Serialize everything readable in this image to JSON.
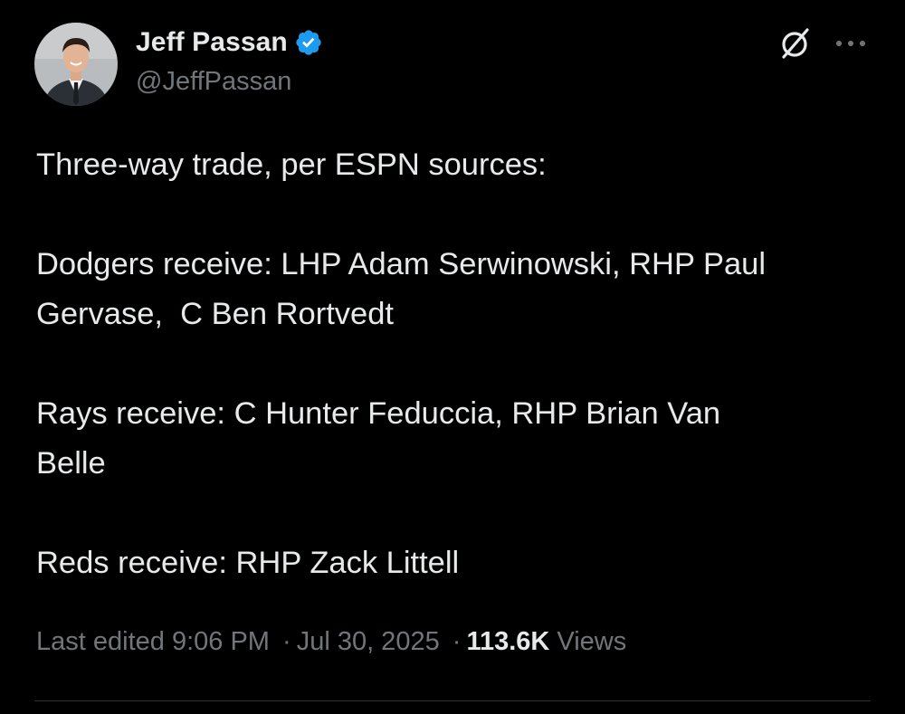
{
  "author": {
    "display_name": "Jeff Passan",
    "handle": "@JeffPassan",
    "verified": true,
    "verified_color": "#1d9bf0"
  },
  "tweet": {
    "lines": [
      "Three-way trade, per ESPN sources:",
      "Dodgers receive: LHP Adam Serwinowski, RHP Paul",
      "Gervase,  C Ben Rortvedt",
      "Rays receive: C Hunter Feduccia, RHP Brian Van",
      "Belle",
      "Reds receive: RHP Zack Littell"
    ]
  },
  "meta": {
    "edited_label": "Last edited",
    "time": "9:06 PM",
    "separator": "·",
    "date": "Jul 30, 2025",
    "views_count": "113.6K",
    "views_label": "Views"
  },
  "icons": {
    "grok": "grok-icon",
    "more": "more-icon",
    "verified": "verified-badge-icon"
  },
  "colors": {
    "background": "#000000",
    "text_primary": "#e7e9ea",
    "text_secondary": "#71767b",
    "divider": "#2f3336"
  }
}
